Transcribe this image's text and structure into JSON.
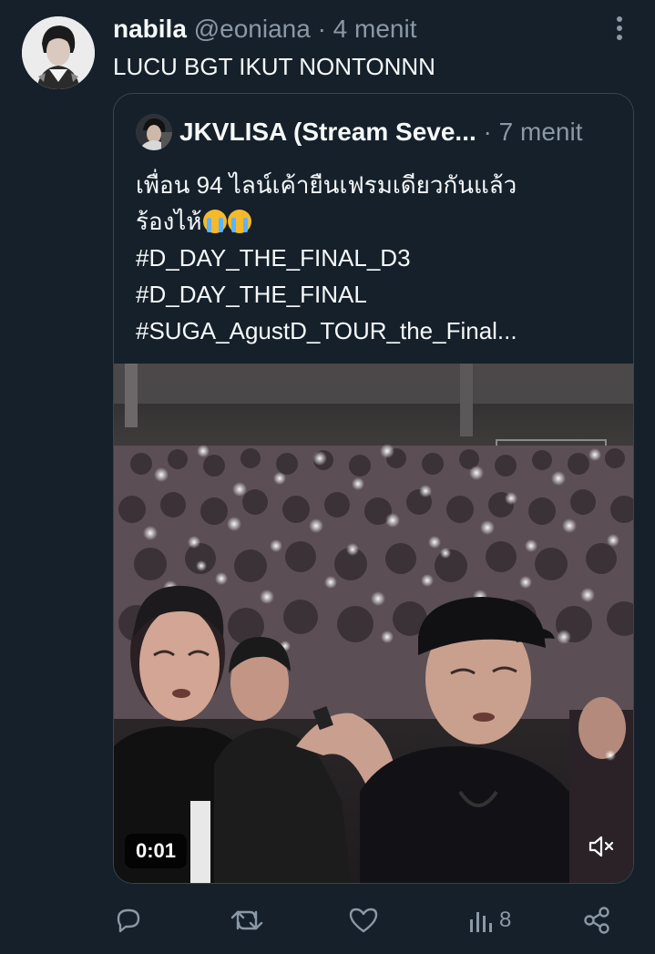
{
  "tweet": {
    "display_name": "nabila",
    "handle": "@eoniana",
    "separator": "·",
    "time": "4 menit",
    "text": "LUCU BGT IKUT NONTONNN"
  },
  "quoted": {
    "display_name": "JKVLISA (Stream Seve...",
    "separator": "·",
    "time": "7 menit",
    "lines": [
      "เพื่อน 94 ไลน์เค้ายืนเฟรมเดียวกันแล้ว",
      "ร้องไห้",
      "#D_DAY_THE_FINAL_D3",
      "#D_DAY_THE_FINAL",
      "#SUGA_AgustD_TOUR_the_Final..."
    ],
    "emoji": [
      "loudly-crying-face",
      "loudly-crying-face"
    ],
    "video": {
      "timestamp": "0:01",
      "mute_icon": "speaker-muted-icon"
    }
  },
  "actions": {
    "reply_icon": "reply-icon",
    "retweet_icon": "retweet-icon",
    "like_icon": "heart-icon",
    "views_icon": "views-icon",
    "views_count": "8",
    "share_icon": "share-icon"
  },
  "colors": {
    "background": "#15202b",
    "text_primary": "#f7f9f9",
    "text_muted": "#8b98a5",
    "border": "#38444d"
  }
}
